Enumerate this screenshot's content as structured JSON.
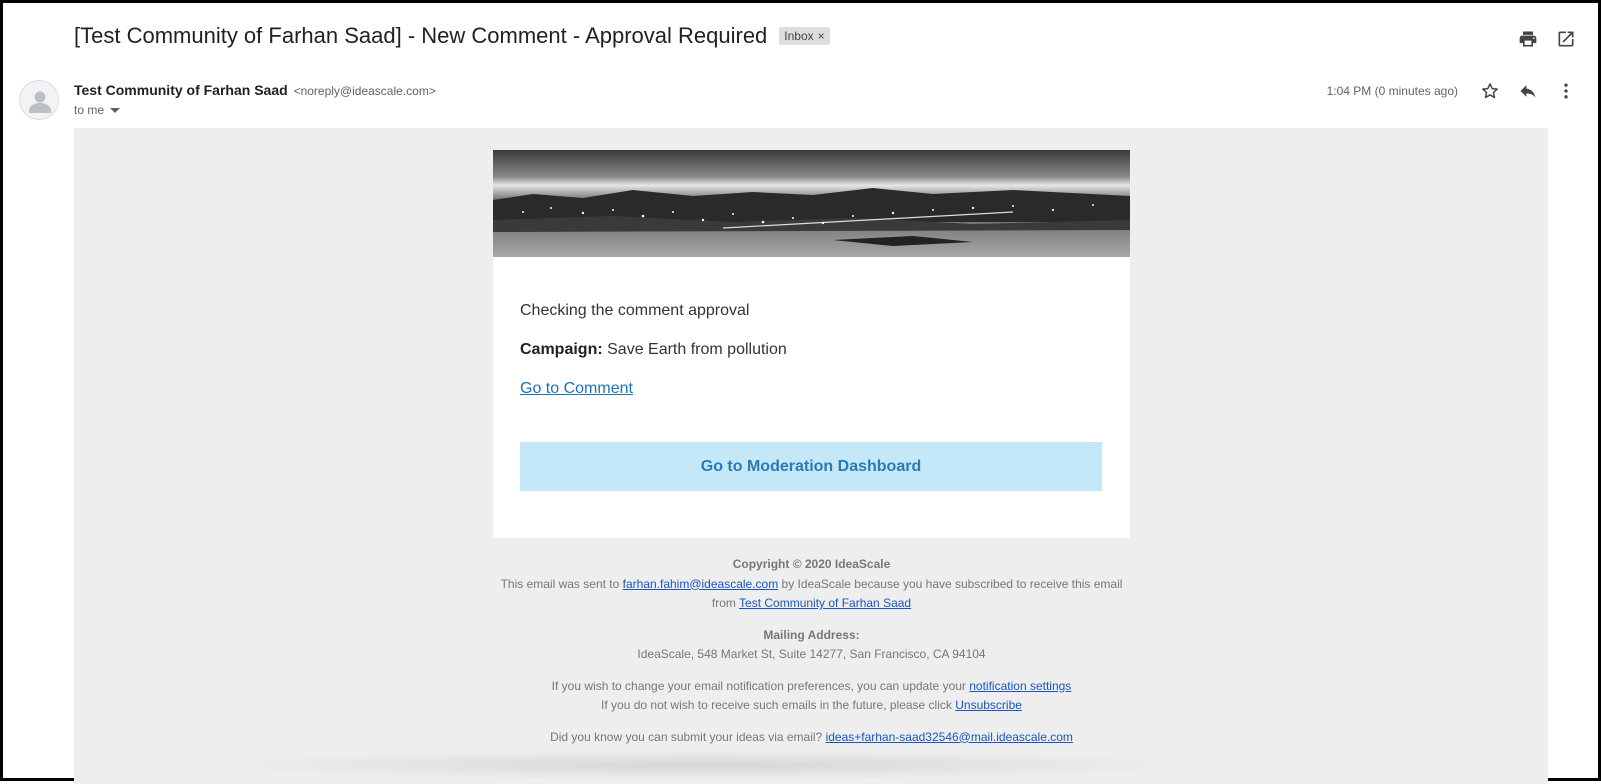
{
  "subject": "[Test Community of Farhan Saad] - New Comment - Approval Required",
  "label_chip": {
    "text": "Inbox",
    "remove": "×"
  },
  "icons": {
    "print": "print-icon",
    "open_new_window": "open-in-new-window-icon",
    "star": "star-icon",
    "reply": "reply-icon",
    "more": "more-vertical-icon",
    "avatar": "person-icon"
  },
  "sender": {
    "name": "Test Community of Farhan Saad",
    "email": "<noreply@ideascale.com>",
    "to": "to me"
  },
  "timestamp": "1:04 PM (0 minutes ago)",
  "email": {
    "comment_text": "Checking the comment approval",
    "campaign_label": "Campaign:",
    "campaign_value": " Save Earth from pollution",
    "go_to_comment": "Go to Comment",
    "moderation_button": "Go to Moderation Dashboard"
  },
  "footer": {
    "copyright": "Copyright © 2020 IdeaScale",
    "sent_to_prefix": "This email was sent to ",
    "sent_to_email": "farhan.fahim@ideascale.com",
    "sent_to_middle": " by IdeaScale because you have subscribed to receive this email from ",
    "community_link": "Test Community of Farhan Saad",
    "mailing_label": "Mailing Address:",
    "mailing_address": "IdeaScale, 548 Market St, Suite 14277, San Francisco, CA 94104",
    "prefs_text": "If you wish to change your email notification preferences, you can update your ",
    "prefs_link": "notification settings",
    "unsub_text": "If you do not wish to receive such emails in the future, please click ",
    "unsub_link": "Unsubscribe",
    "ideas_text": "Did you know you can submit your ideas via email? ",
    "ideas_link": "ideas+farhan-saad32546@mail.ideascale.com"
  },
  "colors": {
    "link": "#1a56c0",
    "button_bg": "#c4e8f8",
    "button_text": "#2a7ab8",
    "body_bg": "#eeeeee"
  }
}
